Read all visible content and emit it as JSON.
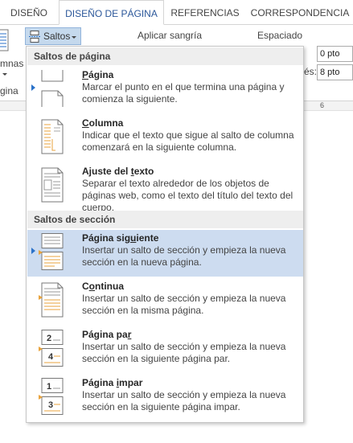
{
  "tabs": [
    "DISEÑO",
    "DISEÑO DE PÁGINA",
    "REFERENCIAS",
    "CORRESPONDENCIA"
  ],
  "ribbon": {
    "saltos_label": "Saltos",
    "columns_partial": "mnas",
    "page_partial": "gina",
    "aplicar_sangria": "Aplicar sangría",
    "espaciado": "Espaciado",
    "spacing_before_label": "",
    "spacing_after_label": "és:",
    "spacing_before_value": "0 pto",
    "spacing_after_value": "8 pto",
    "ruler_mark": "6"
  },
  "menu": {
    "section_page": "Saltos de página",
    "section_section": "Saltos de sección",
    "items": [
      {
        "title_pre": "",
        "title_ul": "P",
        "title_post": "ágina",
        "desc": "Marcar el punto en el que termina una página y comienza la siguiente."
      },
      {
        "title_pre": "",
        "title_ul": "C",
        "title_post": "olumna",
        "desc": "Indicar que el texto que sigue al salto de columna comenzará en la siguiente columna."
      },
      {
        "title_pre": "Ajuste del ",
        "title_ul": "t",
        "title_post": "exto",
        "desc": "Separar el texto alrededor de los objetos de páginas web, como el texto del título del texto del cuerpo."
      },
      {
        "title_pre": "Página sig",
        "title_ul": "u",
        "title_post": "iente",
        "desc": "Insertar un salto de sección y empieza la nueva sección en la nueva página."
      },
      {
        "title_pre": "C",
        "title_ul": "o",
        "title_post": "ntinua",
        "desc": "Insertar un salto de sección y empieza la nueva sección en la misma página."
      },
      {
        "title_pre": "Página pa",
        "title_ul": "r",
        "title_post": "",
        "desc": "Insertar un salto de sección y empieza la nueva sección en la siguiente página par."
      },
      {
        "title_pre": "Página ",
        "title_ul": "i",
        "title_post": "mpar",
        "desc": "Insertar un salto de sección y empieza la nueva sección en la siguiente página impar."
      }
    ],
    "icon_nums": {
      "even_a": "2",
      "even_b": "4",
      "odd_a": "1",
      "odd_b": "3"
    }
  },
  "colors": {
    "accent": "#2b579a",
    "highlight": "#cddcf0",
    "icon_orange": "#e8a33d"
  }
}
